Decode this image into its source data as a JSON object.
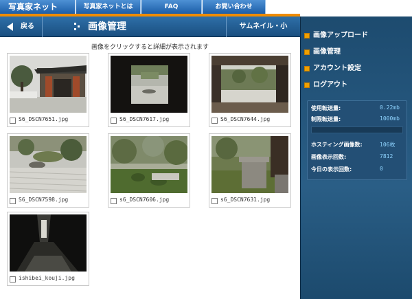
{
  "site": {
    "title": "写真家ネット",
    "nav": [
      "写真家ネットとは",
      "FAQ",
      "お問い合わせ"
    ]
  },
  "header": {
    "back_label": "戻る",
    "title": "画像管理",
    "thumb_size": "サムネイル・小"
  },
  "main": {
    "instruction": "画像をクリックすると詳細が表示されます",
    "images": [
      {
        "file": "S6_DSCN7651.jpg"
      },
      {
        "file": "S6_DSCN7617.jpg"
      },
      {
        "file": "S6_DSCN7644.jpg"
      },
      {
        "file": "S6_DSCN7598.jpg"
      },
      {
        "file": "s6_DSCN7606.jpg"
      },
      {
        "file": "s6_DSCN7631.jpg"
      },
      {
        "file": "ishibei_kouji.jpg"
      }
    ]
  },
  "sidebar": {
    "items": [
      "画像アップロード",
      "画像管理",
      "アカウント設定",
      "ログアウト"
    ],
    "stats": {
      "used_label": "使用転送量:",
      "used_value": "0.22mb",
      "limit_label": "制限転送量:",
      "limit_value": "1000mb",
      "hosting_label": "ホスティング画像数:",
      "hosting_value": "106枚",
      "views_label": "画像表示回数:",
      "views_value": "7812",
      "today_label": "今日の表示回数:",
      "today_value": "0"
    }
  },
  "colors": {
    "accent": "#f08c00",
    "nav_blue": "#1c5ea8",
    "sidebar": "#1d4b6f"
  }
}
